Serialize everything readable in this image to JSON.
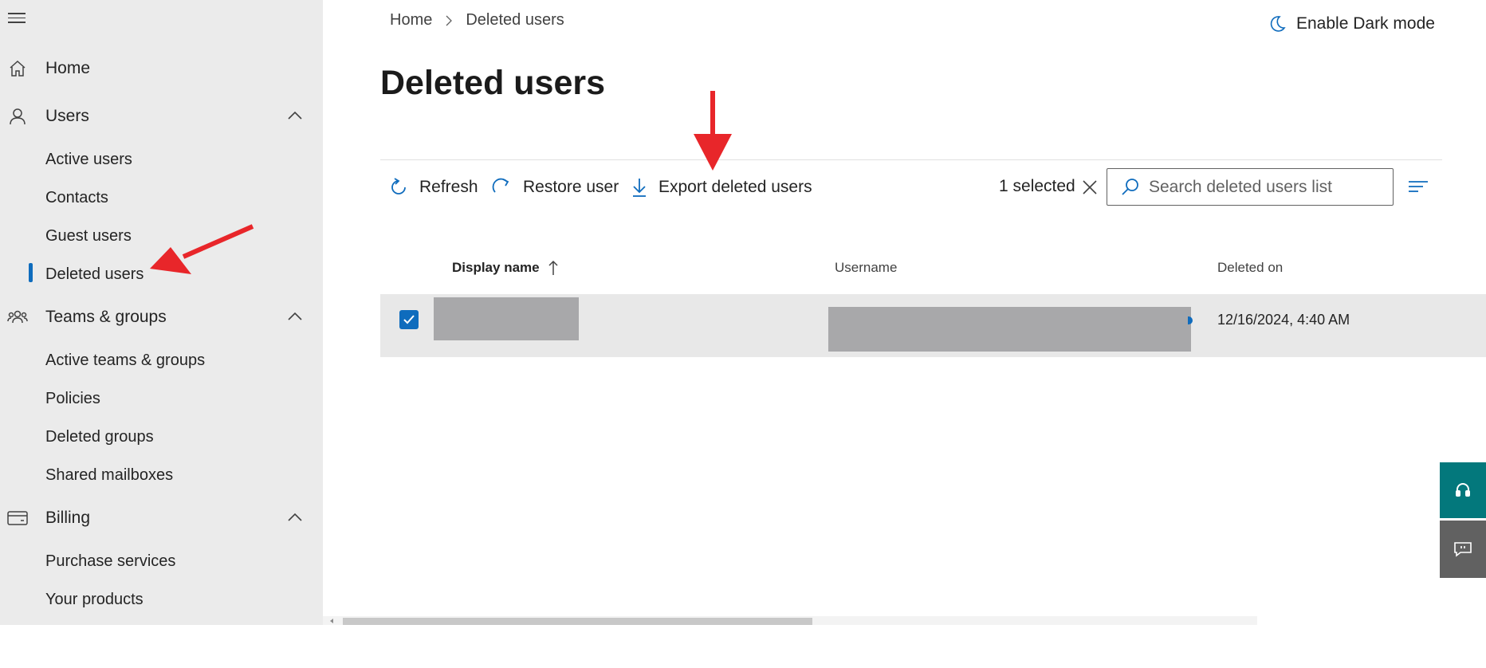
{
  "sidebar": {
    "top_items": [
      {
        "label": "Home",
        "icon": "home-icon"
      },
      {
        "label": "Users",
        "icon": "person-icon"
      },
      {
        "label": "Teams & groups",
        "icon": "people-team-icon"
      },
      {
        "label": "Billing",
        "icon": "credit-card-icon"
      }
    ],
    "users_sub": [
      "Active users",
      "Contacts",
      "Guest users",
      "Deleted users"
    ],
    "teams_sub": [
      "Active teams & groups",
      "Policies",
      "Deleted groups",
      "Shared mailboxes"
    ],
    "billing_sub": [
      "Purchase services",
      "Your products"
    ],
    "active_item": "Deleted users"
  },
  "breadcrumb": {
    "home": "Home",
    "current": "Deleted users"
  },
  "header": {
    "dark_mode_label": "Enable Dark mode"
  },
  "page": {
    "title": "Deleted users"
  },
  "toolbar": {
    "refresh_label": "Refresh",
    "restore_label": "Restore user",
    "export_label": "Export deleted users",
    "selected_count": "1 selected"
  },
  "search": {
    "placeholder": "Search deleted users list"
  },
  "table": {
    "columns": [
      "Display name",
      "Username",
      "Deleted on"
    ],
    "rows": [
      {
        "display_name": "",
        "username": "",
        "deleted_on": "12/16/2024, 4:40 AM",
        "selected": true
      }
    ]
  },
  "colors": {
    "accent": "#0f6cbd",
    "sidebar_bg": "#ebebeb",
    "support_button": "#03787c",
    "feedback_button": "#616161",
    "annotation_arrow": "#e8262a"
  }
}
